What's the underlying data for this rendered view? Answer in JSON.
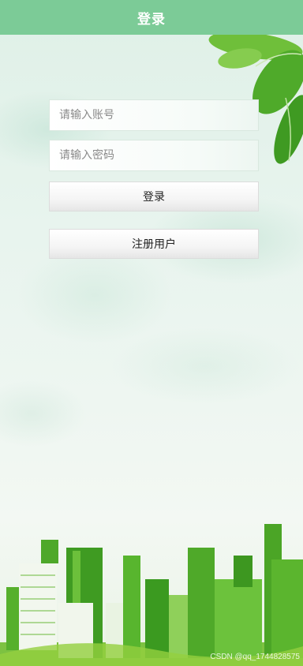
{
  "header": {
    "title": "登录"
  },
  "form": {
    "account_placeholder": "请输入账号",
    "password_placeholder": "请输入密码",
    "login_label": "登录",
    "register_label": "注册用户"
  },
  "watermark": "CSDN @qq_1744828575",
  "colors": {
    "header": "#7ccb97",
    "accent_green": "#5cb531",
    "button_text": "#222222"
  },
  "icons": [
    "leaves-decoration",
    "city-skyline-illustration"
  ]
}
